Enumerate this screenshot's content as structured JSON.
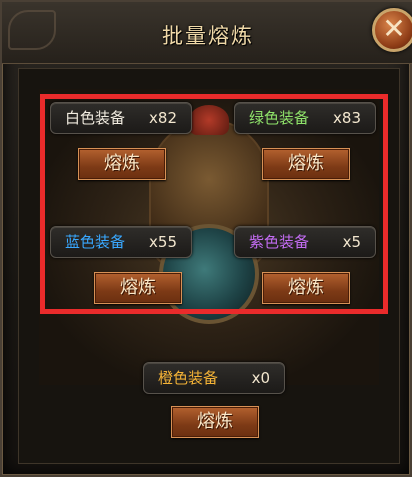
{
  "window": {
    "title": "批量熔炼",
    "close_icon": "close-icon"
  },
  "groups": [
    {
      "name": "白色装备",
      "count": "x82",
      "color": "#f1ece0",
      "button": "熔炼"
    },
    {
      "name": "绿色装备",
      "count": "x83",
      "color": "#8fe36a",
      "button": "熔炼"
    },
    {
      "name": "蓝色装备",
      "count": "x55",
      "color": "#39a8ff",
      "button": "熔炼"
    },
    {
      "name": "紫色装备",
      "count": "x5",
      "color": "#c36cf3",
      "button": "熔炼"
    },
    {
      "name": "橙色装备",
      "count": "x0",
      "color": "#f3b236",
      "button": "熔炼"
    }
  ],
  "colors": {
    "highlight": "#ea2b2b",
    "title": "#f0d9a8"
  }
}
